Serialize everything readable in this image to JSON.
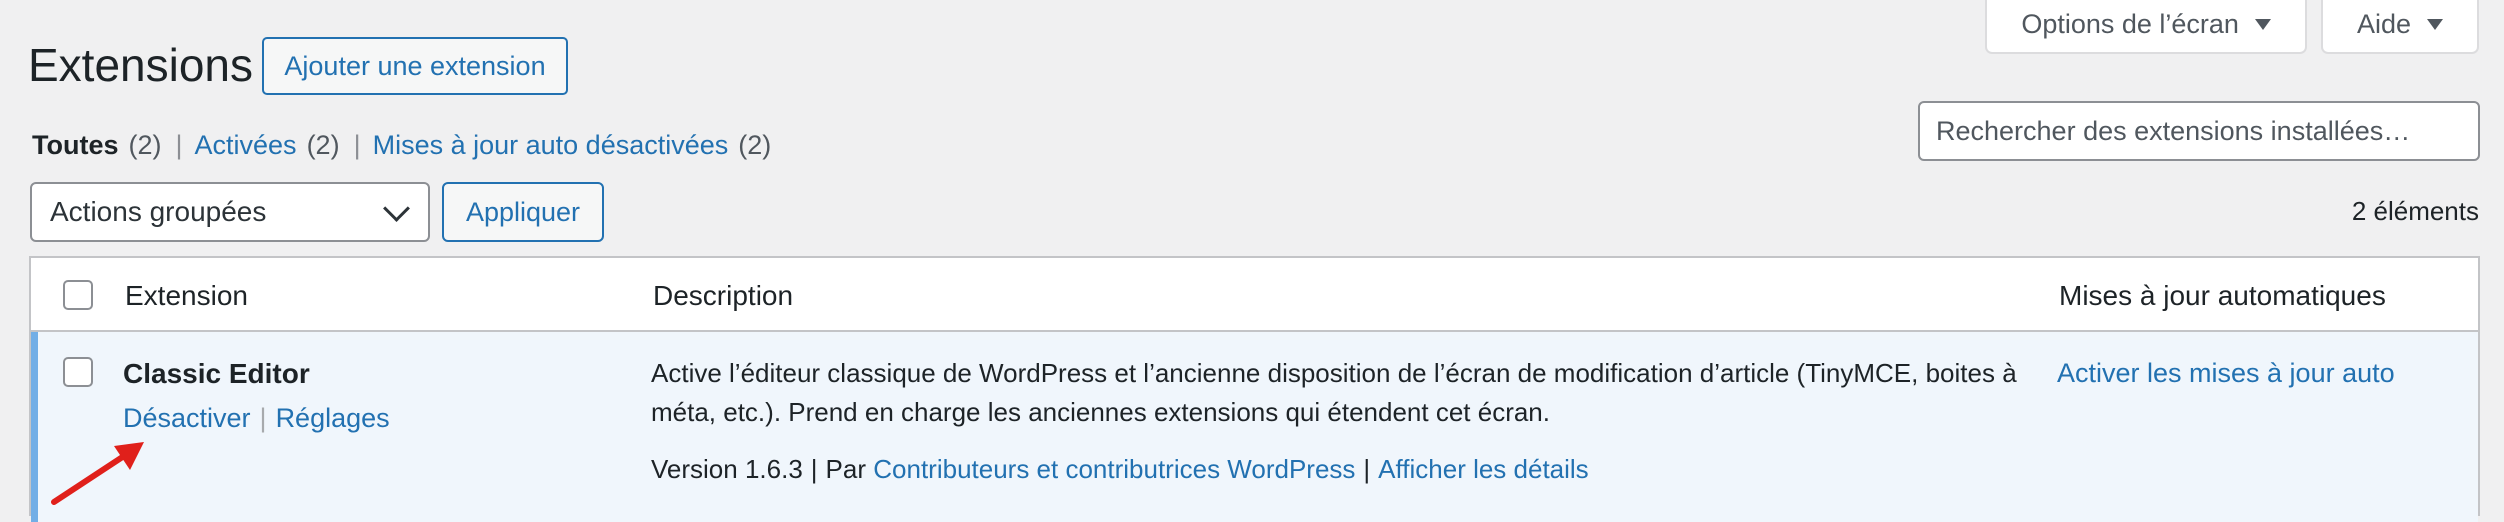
{
  "screen_meta": {
    "options_label": "Options de l’écran",
    "help_label": "Aide"
  },
  "header": {
    "title": "Extensions",
    "add_button": "Ajouter une extension"
  },
  "filters": [
    {
      "label": "Toutes",
      "count": "(2)",
      "current": true
    },
    {
      "label": "Activées",
      "count": "(2)",
      "current": false
    },
    {
      "label": "Mises à jour auto désactivées",
      "count": "(2)",
      "current": false
    }
  ],
  "search": {
    "placeholder": "Rechercher des extensions installées…"
  },
  "bulk": {
    "selected": "Actions groupées",
    "apply_label": "Appliquer"
  },
  "items_count": "2 éléments",
  "table": {
    "columns": [
      "Extension",
      "Description",
      "Mises à jour automatiques"
    ],
    "rows": [
      {
        "name": "Classic Editor",
        "actions": [
          "Désactiver",
          "Réglages"
        ],
        "description": "Active l’éditeur classique de WordPress et l’ancienne disposition de l’écran de modification d’article (TinyMCE, boites à méta, etc.). Prend en charge les anciennes extensions qui étendent cet écran.",
        "version": "Version 1.6.3",
        "by_label": "Par",
        "author": "Contributeurs et contributrices WordPress",
        "details_link": "Afficher les détails",
        "auto_update_link": "Activer les mises à jour auto"
      }
    ]
  },
  "colors": {
    "link": "#2271b1",
    "active_row_bg": "#f0f6fc",
    "active_accent": "#72aee6",
    "annotation_arrow": "#e0201b"
  }
}
